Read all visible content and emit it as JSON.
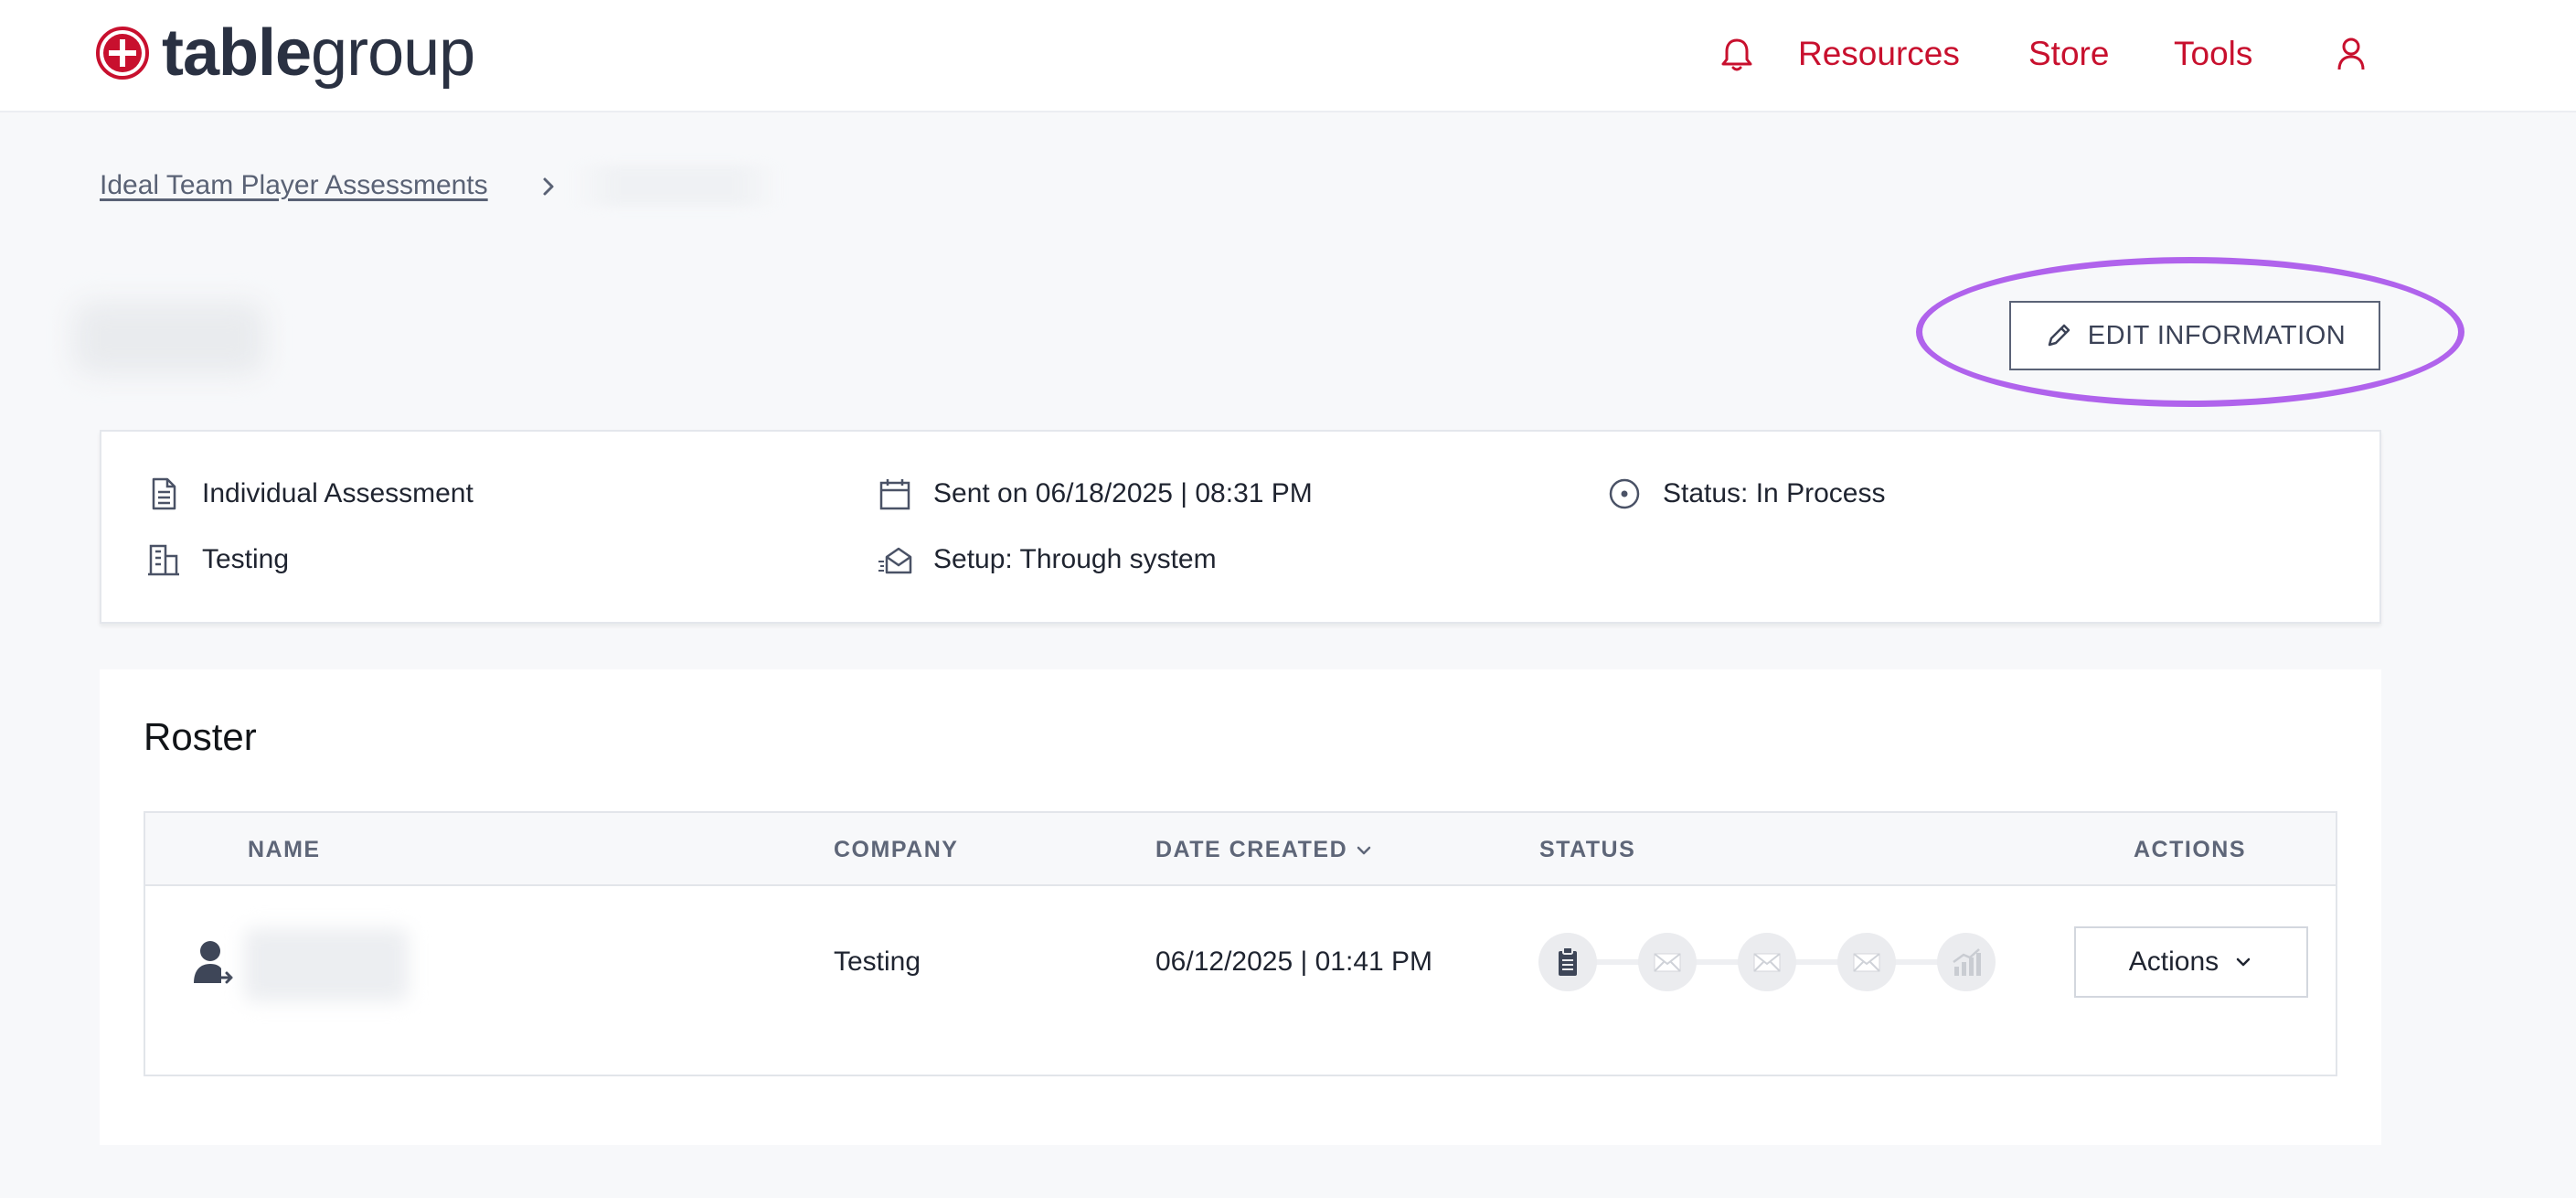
{
  "brand": {
    "logo_bold": "table",
    "logo_light": "group",
    "accent": "#c8102e"
  },
  "nav": {
    "icons": [
      "bell-icon",
      "user-icon"
    ],
    "items": [
      {
        "label": "Resources"
      },
      {
        "label": "Store"
      },
      {
        "label": "Tools"
      }
    ]
  },
  "breadcrumb": {
    "parent": "Ideal Team Player Assessments",
    "separator_icon": "chevron-right-icon"
  },
  "edit_button": {
    "label": "EDIT INFORMATION",
    "icon": "pencil-icon",
    "highlight_color": "#b063ec"
  },
  "info": {
    "assessment_type": "Individual Assessment",
    "sent_on": "Sent on 06/18/2025 | 08:31 PM",
    "status": "Status: In Process",
    "company": "Testing",
    "setup": "Setup: Through system"
  },
  "roster": {
    "title": "Roster",
    "columns": {
      "name": "NAME",
      "company": "COMPANY",
      "date_created": "DATE CREATED",
      "status": "STATUS",
      "actions": "ACTIONS"
    },
    "rows": [
      {
        "company": "Testing",
        "date_created": "06/12/2025 | 01:41 PM",
        "status_steps": [
          "clipboard-icon",
          "mail-icon",
          "mail-icon",
          "mail-icon",
          "chart-icon"
        ],
        "actions_label": "Actions"
      }
    ]
  }
}
